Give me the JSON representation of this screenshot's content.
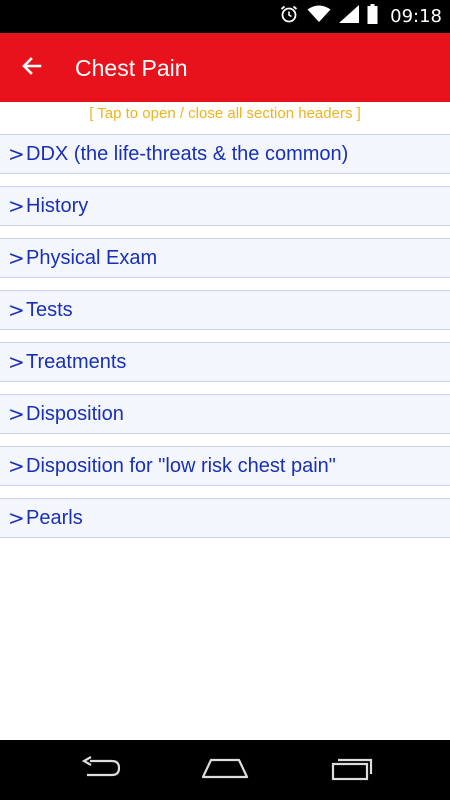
{
  "status_bar": {
    "time": "09:18",
    "icons": [
      "alarm-icon",
      "wifi-icon",
      "signal-icon",
      "battery-icon"
    ]
  },
  "app_bar": {
    "title": "Chest Pain",
    "back_icon": "arrow-left-icon",
    "background_color": "#e8121c"
  },
  "hint": "[ Tap to open / close all section headers ]",
  "sections": [
    {
      "chevron": ">",
      "label": "DDX (the life-threats & the common)"
    },
    {
      "chevron": ">",
      "label": "History"
    },
    {
      "chevron": ">",
      "label": "Physical Exam"
    },
    {
      "chevron": ">",
      "label": "Tests"
    },
    {
      "chevron": ">",
      "label": "Treatments"
    },
    {
      "chevron": ">",
      "label": "Disposition"
    },
    {
      "chevron": ">",
      "label": "Disposition for \"low risk chest pain\""
    },
    {
      "chevron": ">",
      "label": "Pearls"
    }
  ],
  "nav_bar": {
    "buttons": [
      "back-icon",
      "home-icon",
      "recents-icon"
    ]
  },
  "colors": {
    "accent": "#e8121c",
    "hint": "#f0b21e",
    "section_text": "#1a2fb7",
    "section_bg": "#f3f6fd"
  }
}
